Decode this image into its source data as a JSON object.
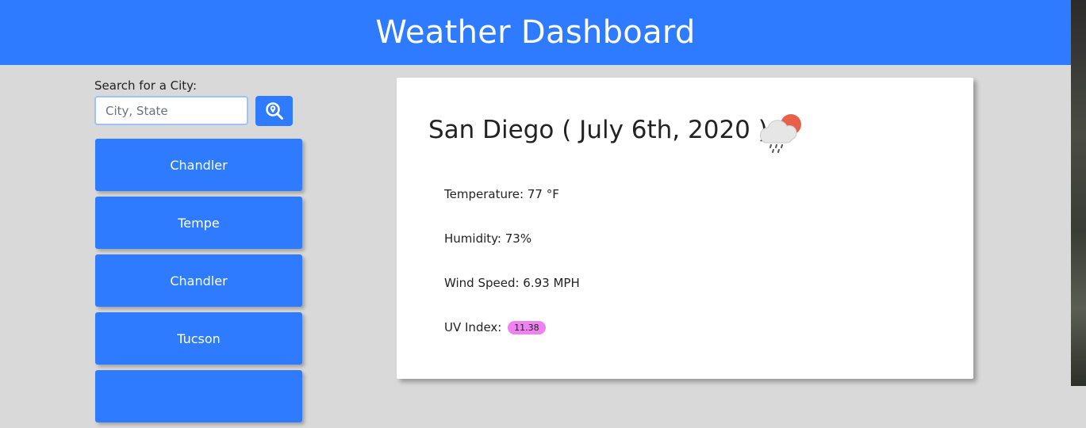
{
  "header": {
    "title": "Weather Dashboard"
  },
  "search": {
    "label": "Search for a City:",
    "placeholder": "City, State",
    "button_icon": "search-location-icon"
  },
  "history": [
    {
      "label": "Chandler"
    },
    {
      "label": "Tempe"
    },
    {
      "label": "Chandler"
    },
    {
      "label": "Tucson"
    },
    {
      "label": ""
    }
  ],
  "current": {
    "title": "San Diego ( July 6th, 2020 )",
    "icon": "sun-cloud-rain-icon",
    "temperature": "Temperature: 77 °F",
    "humidity": "Humidity: 73%",
    "wind": "Wind Speed: 6.93 MPH",
    "uv_label": "UV Index:",
    "uv_value": "11.38"
  },
  "colors": {
    "accent": "#2f7bff",
    "background": "#d9d9d9",
    "uv_badge": "#ee82ee",
    "sun": "#e8604a"
  }
}
